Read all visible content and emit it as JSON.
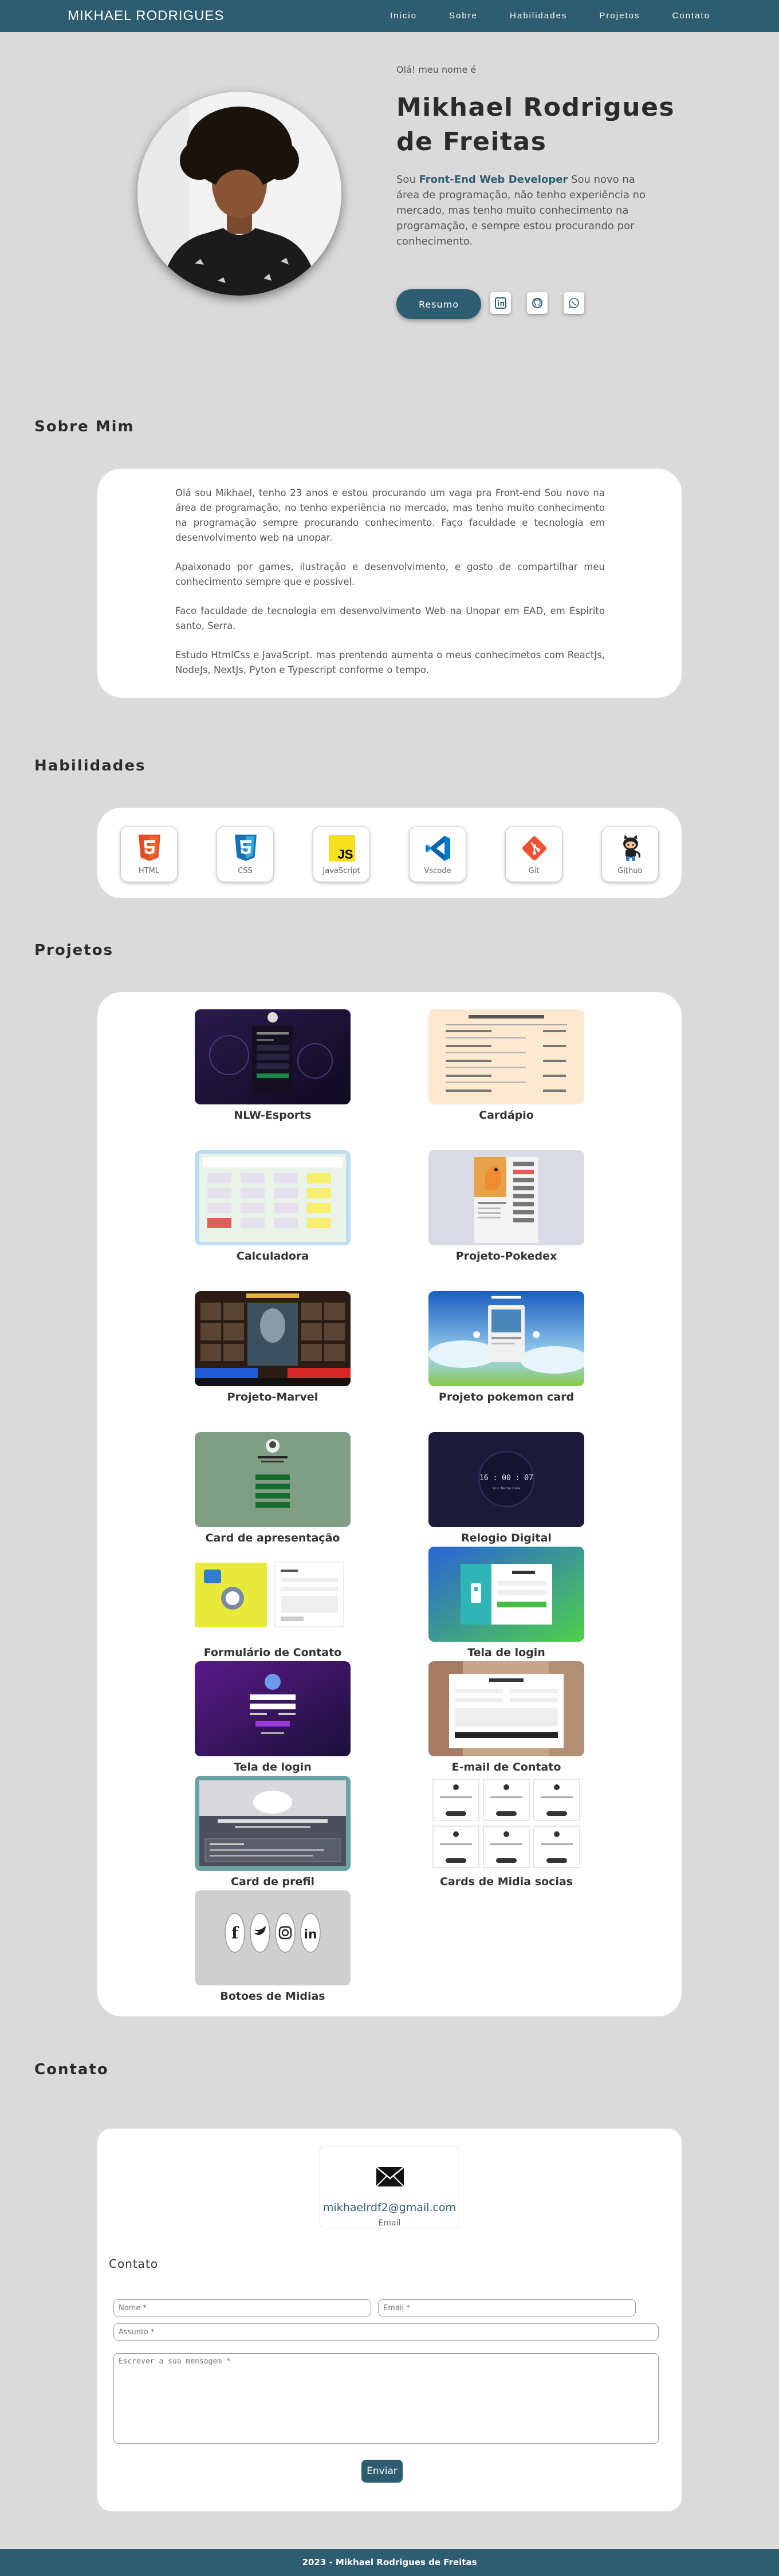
{
  "nav": {
    "logo": "MIKHAEL RODRIGUES",
    "links": [
      "Inicio",
      "Sobre",
      "Habilidades",
      "Projetos",
      "Contato"
    ]
  },
  "hero": {
    "greeting": "Olá! meu nome é",
    "name": "Mikhael Rodrigues de Freitas",
    "desc_pre": "Sou ",
    "desc_highlight": "Front-End Web Developer",
    "desc_post": " Sou novo na área de programação, não tenho experiência no mercado, mas tenho muito conhecimento na programação, e sempre estou procurando por conhecimento.",
    "resume_label": "Resumo",
    "social_icons": [
      "linkedin-icon",
      "github-icon",
      "whatsapp-icon"
    ]
  },
  "about": {
    "title": "Sobre Mim",
    "paragraphs": [
      "Olá sou Mikhael, tenho 23 anos e estou procurando um vaga pra Front-end Sou novo na área de programação, no tenho experiência no mercado, mas tenho muito conhecimento na programação sempre procurando conhecimento. Faço faculdade e tecnologia em desenvolvimento web na unopar.",
      "Apaixonado por games, ilustração e desenvolvimento, e gosto de compartilhar meu conhecimento sempre que e possível.",
      "Faco faculdade de tecnologia em desenvolvimento Web na Unopar em EAD, em Espirito santo, Serra.",
      "Estudo HtmlCss e JavaScript. mas prentendo aumenta o meus conhecimetos com ReactJs, NodeJs, NextJs, Pyton e Typescript conforme o tempo."
    ]
  },
  "skills": {
    "title": "Habilidades",
    "items": [
      {
        "label": "HTML",
        "icon": "html5-icon"
      },
      {
        "label": "CSS",
        "icon": "css3-icon"
      },
      {
        "label": "JavaScript",
        "icon": "javascript-icon"
      },
      {
        "label": "Vscode",
        "icon": "vscode-icon"
      },
      {
        "label": "Git",
        "icon": "git-icon"
      },
      {
        "label": "Github",
        "icon": "github-octocat-icon"
      }
    ]
  },
  "projects": {
    "title": "Projetos",
    "items": [
      "NLW-Esports",
      "Cardápio",
      "Calculadora",
      "Projeto-Pokedex",
      "Projeto-Marvel",
      "Projeto pokemon card",
      "Card de apresentação",
      "Relogio Digital",
      "Formulário de Contato",
      "Tela de login",
      "Tela de login",
      "E-mail de Contato",
      "Card de prefil",
      "Cards de Midia socias",
      "Botoes de Midias"
    ],
    "clock_time": "16 : 00 : 07",
    "clock_caption": "Your Name Here"
  },
  "contact": {
    "title": "Contato",
    "email": "mikhaelrdf2@gmail.com",
    "email_label": "Email",
    "form_title": "Contato",
    "name_placeholder": "Nome *",
    "email_placeholder": "Email *",
    "subject_placeholder": "Assunto *",
    "message_placeholder": "Escrever a sua mensagem *",
    "send_label": "Enviar"
  },
  "footer": {
    "text": "2023 - Mikhael Rodrigues de Freitas"
  },
  "colors": {
    "primary": "#2e5d72",
    "background": "#dadada",
    "card": "#ffffff"
  }
}
